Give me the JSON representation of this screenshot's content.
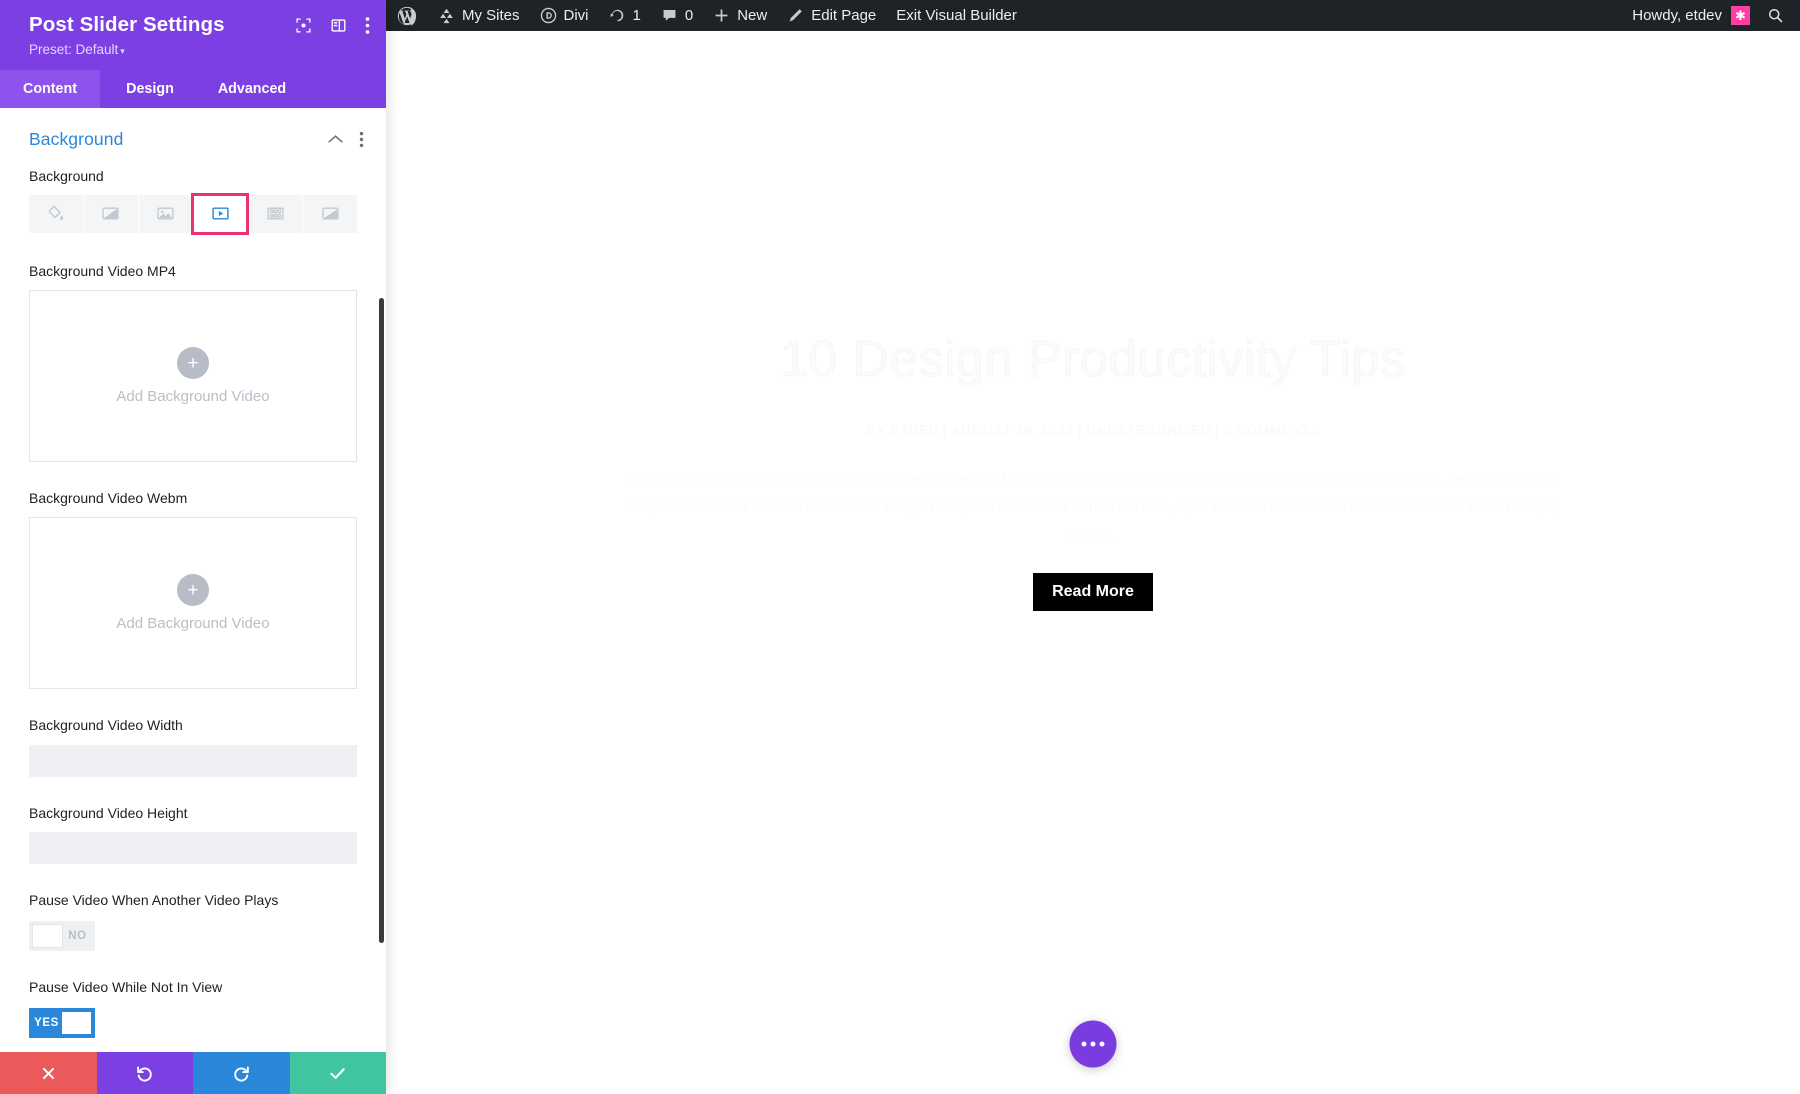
{
  "admin_bar": {
    "wp_logo": "wordpress-logo-icon",
    "items": [
      {
        "icon": "my-sites-icon",
        "label": "My Sites"
      },
      {
        "icon": "divi-icon",
        "label": "Divi"
      },
      {
        "icon": "updates-icon",
        "label": "1"
      },
      {
        "icon": "comments-icon",
        "label": "0"
      },
      {
        "icon": "plus-icon",
        "label": "New"
      },
      {
        "icon": "pencil-icon",
        "label": "Edit Page"
      },
      {
        "icon": "",
        "label": "Exit Visual Builder"
      }
    ],
    "howdy": "Howdy, etdev",
    "avatar_glyph": "✱",
    "search": "search-icon"
  },
  "panel": {
    "title": "Post Slider Settings",
    "preset_label": "Preset: Default",
    "preset_caret": "▾",
    "head_icons": [
      "focus-target-icon",
      "layout-columns-icon",
      "vertical-dots-icon"
    ],
    "tabs": [
      {
        "id": "content",
        "label": "Content",
        "active": true
      },
      {
        "id": "design",
        "label": "Design",
        "active": false
      },
      {
        "id": "advanced",
        "label": "Advanced",
        "active": false
      }
    ],
    "section": {
      "title": "Background",
      "collapse_icon": "chevron-up-icon",
      "menu_icon": "vertical-dots-icon"
    },
    "background_field": {
      "label": "Background",
      "options": [
        {
          "id": "color",
          "icon": "paint-bucket-icon",
          "selected": false
        },
        {
          "id": "gradient",
          "icon": "gradient-icon",
          "selected": false
        },
        {
          "id": "image",
          "icon": "image-icon",
          "selected": false
        },
        {
          "id": "video",
          "icon": "video-play-icon",
          "selected": true
        },
        {
          "id": "pattern",
          "icon": "pattern-icon",
          "selected": false
        },
        {
          "id": "mask",
          "icon": "mask-icon",
          "selected": false
        }
      ],
      "selected_outline_color": "#e8336d"
    },
    "fields": {
      "mp4_label": "Background Video MP4",
      "mp4_upload_text": "Add Background Video",
      "webm_label": "Background Video Webm",
      "webm_upload_text": "Add Background Video",
      "width_label": "Background Video Width",
      "width_value": "",
      "height_label": "Background Video Height",
      "height_value": "",
      "pause_other_label": "Pause Video When Another Video Plays",
      "pause_other_state": "NO",
      "pause_notinview_label": "Pause Video While Not In View",
      "pause_notinview_state": "YES"
    },
    "footer": [
      {
        "id": "close",
        "icon": "close-x-icon",
        "color": "#eb5a5a"
      },
      {
        "id": "undo",
        "icon": "undo-icon",
        "color": "#7b3fe4"
      },
      {
        "id": "redo",
        "icon": "redo-icon",
        "color": "#2b87da"
      },
      {
        "id": "save",
        "icon": "checkmark-icon",
        "color": "#41c4a1"
      }
    ]
  },
  "canvas": {
    "slide_title": "10 Design Productivity Tips",
    "slide_meta": "BY ETDEV | AUGUST 16, 2022 | UNCATEGORIZED | 0 COMMENTS",
    "slide_body": "The standard Lorem Ipsum passage, used since the 1500s \"Lorem ipsum dolor sit amet, consectetur adipiscing elit, sed do eiusmod tempor incididunt ut labore et dolore magna aliqua. Ut enim ad minim veniam, quis nostrud exercitation ullamco laboris nisi ut aliquip ex ea...",
    "read_more": "Read More",
    "fab_icon": "ellipsis-icon"
  }
}
